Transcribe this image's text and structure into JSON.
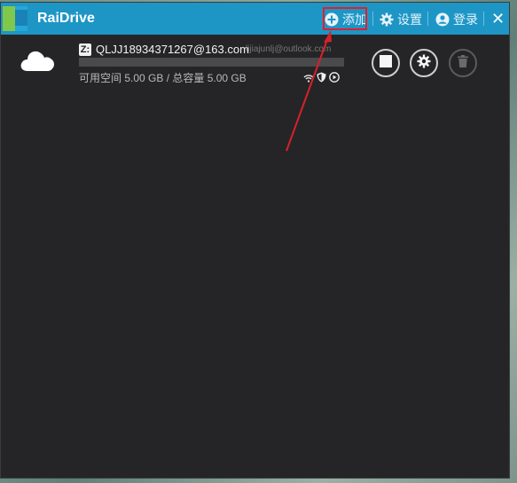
{
  "app": {
    "title": "RaiDrive"
  },
  "toolbar": {
    "add_label": "添加",
    "settings_label": "设置",
    "login_label": "登录",
    "close_label": "✕"
  },
  "drive": {
    "letter": "Z:",
    "name": "QLJJ18934371267@163.com",
    "account": "lijiajunlj@outlook.com",
    "space_text": "可用空间 5.00 GB / 总容量 5.00 GB",
    "usage_fraction": 0.0,
    "icons": [
      "cloud-icon",
      "wifi-icon",
      "shield-icon",
      "play-icon",
      "stop-icon",
      "gear-icon",
      "trash-icon"
    ]
  },
  "colors": {
    "titlebar": "#1d96c6",
    "background": "#252527",
    "annotation": "#e0202a"
  }
}
